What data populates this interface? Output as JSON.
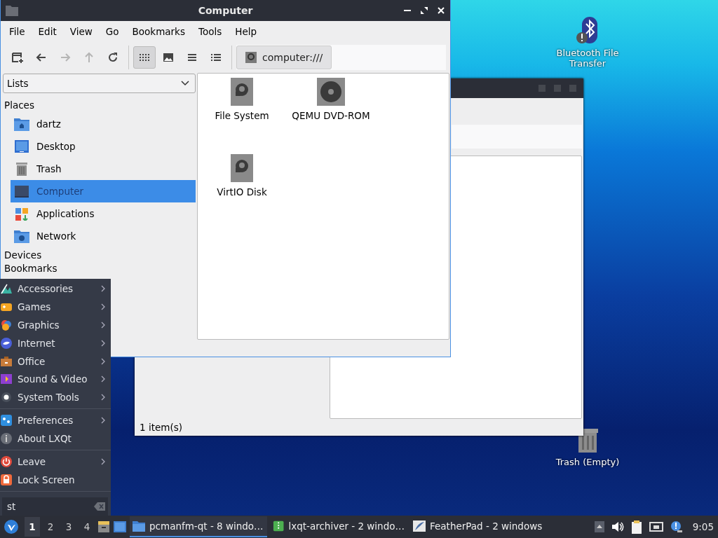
{
  "desktop_icons": [
    {
      "kind": "bluetooth",
      "label": "Bluetooth File Transfer"
    },
    {
      "kind": "trash",
      "label": "Trash (Empty)"
    }
  ],
  "back_window": {
    "status": "1 item(s)"
  },
  "window": {
    "title": "Computer",
    "menu": [
      "File",
      "Edit",
      "View",
      "Go",
      "Bookmarks",
      "Tools",
      "Help"
    ],
    "nav_buttons": [
      {
        "kind": "new-tab",
        "disabled": false
      },
      {
        "kind": "back",
        "disabled": false
      },
      {
        "kind": "forward",
        "disabled": true
      },
      {
        "kind": "up",
        "disabled": true
      },
      {
        "kind": "reload",
        "disabled": false
      }
    ],
    "view_modes": [
      {
        "kind": "icons",
        "selected": true
      },
      {
        "kind": "thumbnails",
        "selected": false
      },
      {
        "kind": "compact",
        "selected": false
      },
      {
        "kind": "details",
        "selected": false
      }
    ],
    "location": "computer:///",
    "side_pane_mode": "Lists",
    "places_heading": "Places",
    "places": [
      {
        "kind": "home",
        "label": "dartz",
        "selected": false
      },
      {
        "kind": "desktop",
        "label": "Desktop",
        "selected": false
      },
      {
        "kind": "trash",
        "label": "Trash",
        "selected": false
      },
      {
        "kind": "computer",
        "label": "Computer",
        "selected": true
      },
      {
        "kind": "applications",
        "label": "Applications",
        "selected": false
      },
      {
        "kind": "network",
        "label": "Network",
        "selected": false
      }
    ],
    "devices_heading": "Devices",
    "bookmarks_heading": "Bookmarks",
    "items": [
      {
        "kind": "disk",
        "label": "File System"
      },
      {
        "kind": "optical",
        "label": "QEMU DVD-ROM"
      },
      {
        "kind": "disk",
        "label": "VirtIO Disk"
      }
    ]
  },
  "start_menu": {
    "sections": [
      [
        {
          "kind": "accessories",
          "label": "Accessories",
          "submenu": true
        },
        {
          "kind": "games",
          "label": "Games",
          "submenu": true
        },
        {
          "kind": "graphics",
          "label": "Graphics",
          "submenu": true
        },
        {
          "kind": "internet",
          "label": "Internet",
          "submenu": true
        },
        {
          "kind": "office",
          "label": "Office",
          "submenu": true
        },
        {
          "kind": "sound",
          "label": "Sound & Video",
          "submenu": true
        },
        {
          "kind": "system",
          "label": "System Tools",
          "submenu": true
        }
      ],
      [
        {
          "kind": "preferences",
          "label": "Preferences",
          "submenu": true
        },
        {
          "kind": "about",
          "label": "About LXQt",
          "submenu": false
        }
      ],
      [
        {
          "kind": "leave",
          "label": "Leave",
          "submenu": true
        },
        {
          "kind": "lock",
          "label": "Lock Screen",
          "submenu": false
        }
      ]
    ],
    "search": "st"
  },
  "taskbar": {
    "desktops": [
      {
        "label": "1",
        "selected": true
      },
      {
        "label": "2",
        "selected": false
      },
      {
        "label": "3",
        "selected": false
      },
      {
        "label": "4",
        "selected": false
      }
    ],
    "tasks": [
      {
        "kind": "folder",
        "label": "pcmanfm-qt - 8 windo…",
        "selected": true
      },
      {
        "kind": "archive",
        "label": "lxqt-archiver - 2 windo…",
        "selected": false
      },
      {
        "kind": "editor",
        "label": "FeatherPad - 2 windows",
        "selected": false
      }
    ],
    "clock": "9:05"
  }
}
